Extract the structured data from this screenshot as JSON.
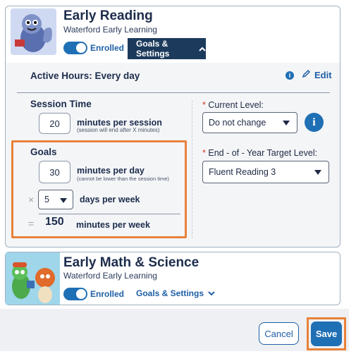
{
  "app1": {
    "title": "Early Reading",
    "subtitle": "Waterford Early Learning",
    "enrolled_label": "Enrolled",
    "tab_label": "Goals & Settings",
    "active_hours": "Active Hours: Every day",
    "edit_label": "Edit",
    "session_time_heading": "Session Time",
    "session_value": "20",
    "session_unit": "minutes per session",
    "session_note": "(session will end after X minutes)",
    "current_level_label": "Current Level:",
    "current_level_value": "Do not change",
    "goals_heading": "Goals",
    "minutes_per_day_value": "30",
    "minutes_per_day_label": "minutes per day",
    "minutes_per_day_note": "(cannot be lower than the session time)",
    "times_symbol": "×",
    "days_value": "5",
    "days_label": "days per week",
    "equals_symbol": "=",
    "total_value": "150",
    "total_label": "minutes per week",
    "target_level_label": "End - of - Year Target Level:",
    "target_level_value": "Fluent Reading 3",
    "required_mark": "*"
  },
  "app2": {
    "title": "Early Math & Science",
    "subtitle": "Waterford Early Learning",
    "enrolled_label": "Enrolled",
    "tab_label": "Goals & Settings"
  },
  "footer": {
    "cancel_label": "Cancel",
    "save_label": "Save"
  },
  "colors": {
    "accent": "#1f6fb5",
    "highlight": "#e8823a",
    "tab_active": "#1c3a5c",
    "panel_bg": "#f4f5f7"
  }
}
